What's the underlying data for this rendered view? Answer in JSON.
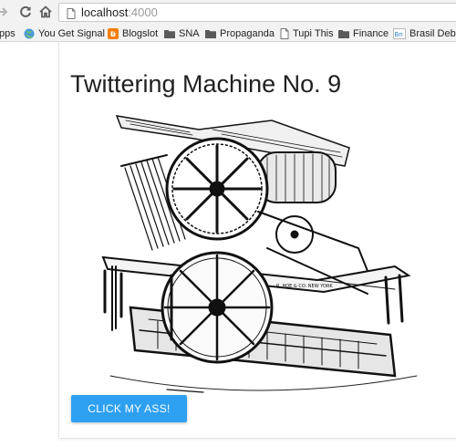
{
  "browser": {
    "url_host": "localhost",
    "url_port": ":4000",
    "bookmarks": [
      {
        "label": "pps",
        "icon": "apps-grid-icon"
      },
      {
        "label": "You Get Signal",
        "icon": "globe-icon"
      },
      {
        "label": "Blogslot",
        "icon": "blogger-icon"
      },
      {
        "label": "SNA",
        "icon": "folder-icon"
      },
      {
        "label": "Propaganda",
        "icon": "folder-icon"
      },
      {
        "label": "Tupi This",
        "icon": "page-icon"
      },
      {
        "label": "Finance",
        "icon": "folder-icon"
      },
      {
        "label": "Brasil Deba",
        "icon": "brasil-debate-icon"
      }
    ]
  },
  "page": {
    "title": "Twittering Machine No. 9",
    "image_subject": "engraving of a cylinder printing press",
    "engraver_mark": "R. HOE & CO. NEW YORK",
    "button_label": "CLICK MY ASS!"
  },
  "colors": {
    "button": "#2ea0f2",
    "blogger": "#f57d00",
    "folder": "#5a5a5a"
  }
}
